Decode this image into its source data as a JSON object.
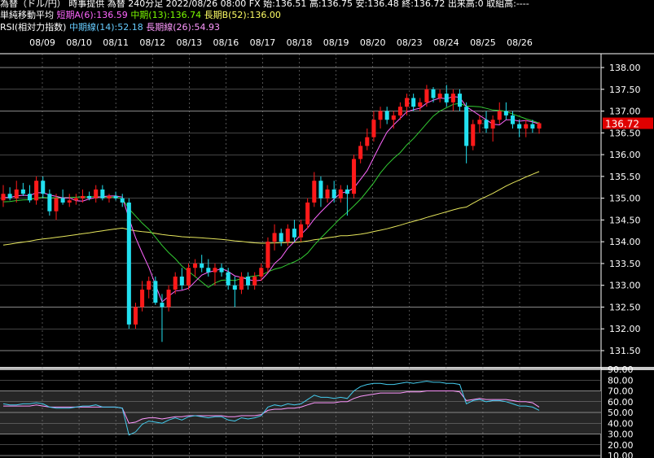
{
  "header": {
    "line1": "為替（ドル/円） 時事提供 為替 240分足 2022/08/26 08:00 FX 始:136.51 高:136.75 安:136.48 終:136.72 出来高:0 取組高:----",
    "sma_label": "単純移動平均",
    "sma_short": "短期A(6):136.59",
    "sma_mid": "中期(13):136.74",
    "sma_long": "長期B(52):136.00",
    "rsi_label": "RSI(相対力指数)",
    "rsi_mid": "中期線(14):52.18",
    "rsi_long": "長期線(26):54.93"
  },
  "colors": {
    "background": "#000000",
    "up": "#ff1a1a",
    "down": "#22e0f0",
    "sma6": "#ff66ff",
    "sma13": "#33cc33",
    "sma52": "#e6e65c",
    "rsi14": "#44ccee",
    "rsi26": "#ff99ff",
    "price_tag": "#e00000",
    "grid": "#888888"
  },
  "chart_data": [
    {
      "type": "candlestick",
      "x_dates": [
        "08/09",
        "08/10",
        "08/11",
        "08/12",
        "08/13",
        "08/16",
        "08/17",
        "08/18",
        "08/19",
        "08/20",
        "08/23",
        "08/24",
        "08/25",
        "08/26"
      ],
      "y_ticks": [
        "138.00",
        "137.50",
        "137.00",
        "136.50",
        "136.00",
        "135.50",
        "135.00",
        "134.50",
        "134.00",
        "133.50",
        "133.00",
        "132.50",
        "132.00",
        "131.50"
      ],
      "ylim": [
        131.2,
        138.3
      ],
      "last_price": "136.72",
      "candles": [
        [
          134.95,
          135.3,
          134.8,
          135.1
        ],
        [
          135.1,
          135.25,
          134.95,
          135.0
        ],
        [
          135.0,
          135.4,
          134.9,
          135.2
        ],
        [
          135.2,
          135.35,
          135.05,
          135.1
        ],
        [
          135.1,
          135.3,
          134.9,
          134.95
        ],
        [
          134.95,
          135.5,
          134.85,
          135.4
        ],
        [
          135.4,
          135.5,
          135.0,
          135.1
        ],
        [
          135.1,
          135.2,
          134.6,
          134.7
        ],
        [
          134.7,
          135.1,
          134.5,
          135.0
        ],
        [
          135.0,
          135.2,
          134.85,
          134.9
        ],
        [
          134.9,
          135.1,
          134.8,
          134.95
        ],
        [
          134.95,
          135.1,
          134.85,
          135.0
        ],
        [
          135.0,
          135.2,
          134.9,
          135.05
        ],
        [
          135.05,
          135.15,
          134.95,
          135.0
        ],
        [
          135.0,
          135.3,
          134.9,
          135.2
        ],
        [
          135.2,
          135.3,
          134.95,
          135.0
        ],
        [
          135.0,
          135.1,
          134.9,
          135.05
        ],
        [
          135.05,
          135.15,
          134.95,
          135.0
        ],
        [
          135.0,
          135.1,
          134.8,
          134.9
        ],
        [
          134.9,
          135.0,
          132.0,
          132.1
        ],
        [
          132.1,
          132.6,
          132.0,
          132.5
        ],
        [
          132.5,
          133.1,
          132.4,
          132.9
        ],
        [
          132.9,
          133.2,
          132.7,
          133.1
        ],
        [
          133.1,
          133.2,
          132.55,
          132.6
        ],
        [
          132.6,
          132.8,
          131.7,
          132.5
        ],
        [
          132.5,
          133.0,
          132.4,
          132.9
        ],
        [
          132.9,
          133.3,
          132.8,
          133.2
        ],
        [
          133.2,
          133.4,
          132.9,
          133.0
        ],
        [
          133.0,
          133.5,
          132.9,
          133.4
        ],
        [
          133.4,
          133.6,
          133.2,
          133.5
        ],
        [
          133.5,
          133.7,
          133.3,
          133.4
        ],
        [
          133.4,
          133.6,
          133.2,
          133.3
        ],
        [
          133.3,
          133.5,
          133.0,
          133.4
        ],
        [
          133.4,
          133.5,
          133.2,
          133.3
        ],
        [
          133.3,
          133.4,
          132.9,
          133.0
        ],
        [
          133.0,
          133.2,
          132.5,
          132.9
        ],
        [
          132.9,
          133.3,
          132.8,
          133.2
        ],
        [
          133.2,
          133.3,
          132.9,
          133.0
        ],
        [
          133.0,
          133.3,
          132.9,
          133.2
        ],
        [
          133.2,
          133.5,
          133.1,
          133.4
        ],
        [
          133.4,
          134.1,
          133.3,
          134.0
        ],
        [
          134.0,
          134.4,
          133.8,
          134.2
        ],
        [
          134.2,
          134.3,
          133.9,
          134.0
        ],
        [
          134.0,
          134.4,
          133.9,
          134.3
        ],
        [
          134.3,
          134.5,
          134.0,
          134.1
        ],
        [
          134.1,
          134.5,
          134.0,
          134.4
        ],
        [
          134.4,
          135.0,
          134.3,
          134.9
        ],
        [
          134.9,
          135.6,
          134.8,
          135.4
        ],
        [
          135.4,
          135.5,
          134.8,
          135.0
        ],
        [
          135.0,
          135.3,
          134.9,
          135.2
        ],
        [
          135.2,
          135.4,
          134.9,
          135.0
        ],
        [
          135.0,
          135.3,
          134.9,
          135.2
        ],
        [
          135.2,
          135.3,
          134.6,
          135.1
        ],
        [
          135.1,
          136.0,
          135.0,
          135.9
        ],
        [
          135.9,
          136.3,
          135.8,
          136.2
        ],
        [
          136.2,
          136.6,
          136.1,
          136.4
        ],
        [
          136.4,
          137.0,
          136.3,
          136.8
        ],
        [
          136.8,
          137.1,
          136.6,
          137.0
        ],
        [
          137.0,
          137.1,
          136.7,
          136.8
        ],
        [
          136.8,
          137.0,
          136.6,
          136.9
        ],
        [
          136.9,
          137.2,
          136.8,
          137.1
        ],
        [
          137.1,
          137.4,
          136.9,
          137.3
        ],
        [
          137.3,
          137.4,
          137.0,
          137.1
        ],
        [
          137.1,
          137.3,
          137.0,
          137.2
        ],
        [
          137.2,
          137.6,
          137.1,
          137.5
        ],
        [
          137.5,
          137.55,
          137.2,
          137.3
        ],
        [
          137.3,
          137.5,
          137.2,
          137.4
        ],
        [
          137.4,
          137.6,
          137.1,
          137.2
        ],
        [
          137.2,
          137.5,
          137.0,
          137.4
        ],
        [
          137.4,
          137.5,
          137.0,
          137.1
        ],
        [
          137.1,
          137.2,
          135.8,
          136.2
        ],
        [
          136.2,
          136.8,
          136.1,
          136.7
        ],
        [
          136.7,
          136.9,
          136.5,
          136.8
        ],
        [
          136.8,
          137.0,
          136.5,
          136.6
        ],
        [
          136.6,
          136.9,
          136.3,
          136.8
        ],
        [
          136.8,
          137.2,
          136.7,
          137.0
        ],
        [
          137.0,
          137.2,
          136.8,
          136.9
        ],
        [
          136.9,
          137.0,
          136.6,
          136.7
        ],
        [
          136.7,
          136.8,
          136.4,
          136.6
        ],
        [
          136.6,
          136.8,
          136.4,
          136.7
        ],
        [
          136.7,
          136.8,
          136.5,
          136.6
        ],
        [
          136.6,
          136.75,
          136.48,
          136.72
        ]
      ]
    },
    {
      "type": "line",
      "y_ticks": [
        "90.00",
        "80.00",
        "70.00",
        "60.00",
        "50.00",
        "40.00",
        "30.00",
        "20.00",
        "10.00"
      ],
      "ylim": [
        7,
        92
      ],
      "series": [
        {
          "name": "中期線(14)",
          "values": [
            58,
            57,
            57,
            58,
            58,
            59,
            58,
            55,
            54,
            54,
            54,
            55,
            56,
            56,
            57,
            55,
            55,
            55,
            54,
            29,
            32,
            39,
            42,
            41,
            40,
            43,
            45,
            43,
            46,
            47,
            46,
            45,
            46,
            46,
            43,
            42,
            45,
            44,
            45,
            47,
            55,
            57,
            56,
            58,
            57,
            58,
            62,
            66,
            64,
            64,
            63,
            64,
            63,
            70,
            74,
            76,
            77,
            77,
            76,
            76,
            77,
            78,
            77,
            78,
            79,
            78,
            78,
            77,
            77,
            76,
            58,
            61,
            62,
            60,
            61,
            61,
            60,
            58,
            56,
            56,
            55,
            52
          ]
        },
        {
          "name": "長期線(26)",
          "values": [
            56,
            56,
            56,
            56,
            56,
            57,
            56,
            55,
            55,
            55,
            55,
            55,
            55,
            55,
            55,
            55,
            55,
            55,
            54,
            40,
            41,
            44,
            45,
            45,
            44,
            45,
            46,
            46,
            47,
            47,
            47,
            47,
            47,
            47,
            46,
            46,
            47,
            47,
            47,
            48,
            52,
            53,
            53,
            54,
            54,
            55,
            57,
            59,
            59,
            59,
            59,
            60,
            60,
            63,
            65,
            66,
            67,
            68,
            68,
            68,
            68,
            69,
            69,
            69,
            70,
            70,
            70,
            70,
            70,
            69,
            61,
            62,
            63,
            62,
            62,
            62,
            62,
            61,
            60,
            60,
            59,
            55
          ]
        }
      ]
    }
  ]
}
